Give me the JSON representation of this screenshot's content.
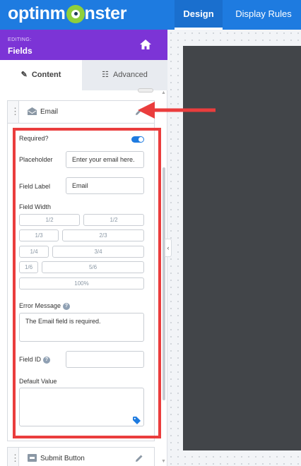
{
  "topbar": {
    "logo_text": "optinmonster",
    "tabs": [
      {
        "label": "Design",
        "active": true
      },
      {
        "label": "Display Rules",
        "active": false
      }
    ]
  },
  "editing": {
    "caption": "EDITING:",
    "title": "Fields",
    "home_icon": "home-icon"
  },
  "side_tabs": [
    {
      "label": "Content",
      "icon": "pencil-icon",
      "active": true
    },
    {
      "label": "Advanced",
      "icon": "sliders-icon",
      "active": false
    }
  ],
  "field_rows": [
    {
      "label": "Email",
      "icon": "envelope-icon",
      "expanded": true
    },
    {
      "label": "Submit Button",
      "icon": "button-icon",
      "expanded": false
    }
  ],
  "email_field": {
    "required_label": "Required?",
    "required_on": true,
    "placeholder_label": "Placeholder",
    "placeholder_value": "Enter your email here.",
    "field_label_label": "Field Label",
    "field_label_value": "Email",
    "width_label": "Field Width",
    "width_options": [
      "1/2",
      "1/2",
      "1/3",
      "2/3",
      "1/4",
      "3/4",
      "1/6",
      "5/6",
      "100%"
    ],
    "error_label": "Error Message",
    "error_value": "The Email field is required.",
    "id_label": "Field ID",
    "id_value": "",
    "default_label": "Default Value",
    "default_value": ""
  },
  "colors": {
    "topbar": "#1e7be0",
    "editing_header": "#7c34d6",
    "annotation": "#ea3d3d",
    "preview": "#424549"
  }
}
